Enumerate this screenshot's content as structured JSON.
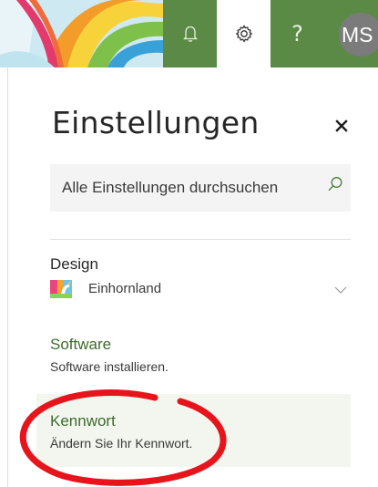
{
  "header": {
    "banner_image": "rainbow-theme-banner",
    "notification_icon": "bell-icon",
    "settings_icon": "gear-icon",
    "help_label": "?",
    "avatar_initials": "MS",
    "accent_color": "#5a8a45"
  },
  "panel": {
    "title": "Einstellungen",
    "close_icon": "close-icon",
    "search": {
      "placeholder": "Alle Einstellungen durchsuchen",
      "icon": "search-icon"
    },
    "design": {
      "label": "Design",
      "value": "Einhornland",
      "thumbnail": "unicorn-theme-thumbnail",
      "dropdown_icon": "chevron-down-icon"
    },
    "items": [
      {
        "title": "Software",
        "subtitle": "Software installieren."
      },
      {
        "title": "Kennwort",
        "subtitle": "Ändern Sie Ihr Kennwort."
      }
    ]
  },
  "annotation": {
    "shape": "ellipse",
    "color": "#e8141c"
  }
}
